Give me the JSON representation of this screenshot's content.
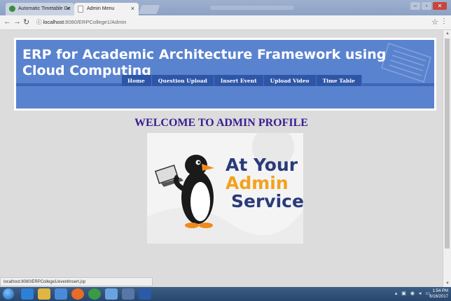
{
  "browser": {
    "tabs": [
      {
        "label": "Automatic Timetable Ge",
        "active": false
      },
      {
        "label": "Admin Menu",
        "active": true
      }
    ],
    "url_host": "localhost",
    "url_path": ":8080/ERPCollege1/Admin",
    "status_url": "localhost:8080/ERPCollege1/eventInsert.jsp"
  },
  "site": {
    "title": "ERP for Academic Architecture Framework using Cloud Computing",
    "menu": [
      "Home",
      "Question Upload",
      "Insert Event",
      "Upload Video",
      "Time Table"
    ],
    "header_color": "#5a83cf",
    "menu_color": "#2e56a6"
  },
  "page": {
    "welcome": "WELCOME TO ADMIN PROFILE",
    "image_text": {
      "line1": "At Your",
      "line2": "Admin",
      "line3": "Service"
    }
  },
  "taskbar": {
    "time": "1:54 PM",
    "date": "6/16/2017"
  }
}
